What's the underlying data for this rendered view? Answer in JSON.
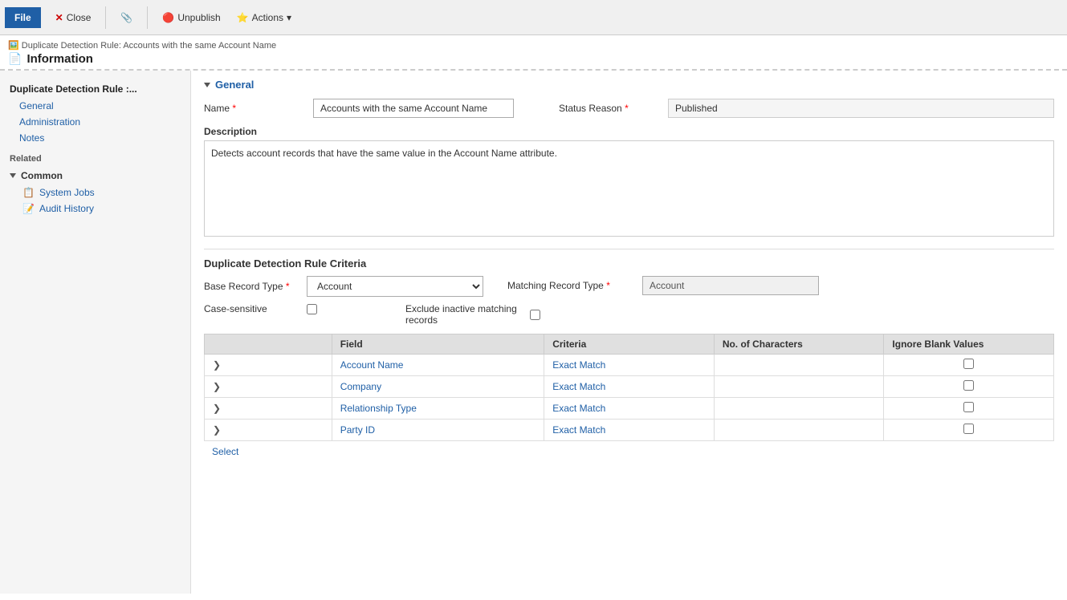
{
  "toolbar": {
    "file_label": "File",
    "close_label": "Close",
    "unpublish_label": "Unpublish",
    "actions_label": "Actions",
    "separator": "|"
  },
  "breadcrumb": {
    "text": "Duplicate Detection Rule: Accounts with the same Account Name",
    "page_title": "Information"
  },
  "sidebar": {
    "section_title": "Duplicate Detection Rule :...",
    "nav_items": [
      {
        "id": "general",
        "label": "General"
      },
      {
        "id": "administration",
        "label": "Administration"
      },
      {
        "id": "notes",
        "label": "Notes"
      }
    ],
    "related_label": "Related",
    "common_group": {
      "label": "Common",
      "items": [
        {
          "id": "system-jobs",
          "label": "System Jobs"
        },
        {
          "id": "audit-history",
          "label": "Audit History"
        }
      ]
    }
  },
  "general_section": {
    "title": "General",
    "name_label": "Name",
    "name_value": "Accounts with the same Account Name",
    "status_reason_label": "Status Reason",
    "status_reason_value": "Published",
    "description_label": "Description",
    "description_value": "Detects account records that have the same value in the Account Name attribute."
  },
  "criteria_section": {
    "title": "Duplicate Detection Rule Criteria",
    "base_record_type_label": "Base Record Type",
    "base_record_type_value": "Account",
    "matching_record_type_label": "Matching Record Type",
    "matching_record_type_value": "Account",
    "case_sensitive_label": "Case-sensitive",
    "exclude_inactive_label": "Exclude inactive matching",
    "exclude_inactive_label2": "records",
    "table": {
      "columns": [
        "",
        "Field",
        "Criteria",
        "No. of Characters",
        "Ignore Blank Values"
      ],
      "rows": [
        {
          "field": "Account Name",
          "criteria": "Exact Match",
          "chars": "",
          "ignore": false
        },
        {
          "field": "Company",
          "criteria": "Exact Match",
          "chars": "",
          "ignore": false
        },
        {
          "field": "Relationship Type",
          "criteria": "Exact Match",
          "chars": "",
          "ignore": false
        },
        {
          "field": "Party ID",
          "criteria": "Exact Match",
          "chars": "",
          "ignore": false
        }
      ],
      "select_link": "Select"
    }
  }
}
